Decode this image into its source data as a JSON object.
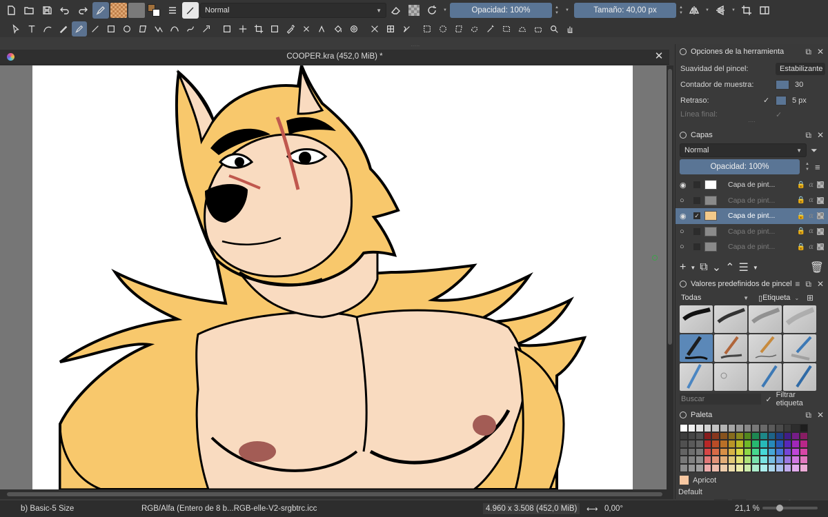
{
  "toolbar": {
    "blend_mode": "Normal",
    "opacity_label": "Opacidad: 100%",
    "size_label": "Tamaño: 40,00 px",
    "fg_color": "#a0703c",
    "bg_color": "#ffffff"
  },
  "document": {
    "title": "COOPER.kra (452,0 MiB) *"
  },
  "tool_options": {
    "title": "Opciones de la herramienta",
    "smoothing_label": "Suavidad del pincel:",
    "smoothing_value": "Estabilizante",
    "sample_label": "Contador de muestra:",
    "sample_value": "30",
    "delay_label": "Retraso:",
    "delay_value": "5 px",
    "final_label": "Línea final:"
  },
  "layers": {
    "title": "Capas",
    "blend_mode": "Normal",
    "opacity_label": "Opacidad:  100%",
    "items": [
      {
        "name": "Capa de pint...",
        "visible": true,
        "state": "normal",
        "thumb": "#ffffff"
      },
      {
        "name": "Capa de pint...",
        "visible": false,
        "state": "dim",
        "thumb": "#8a8a8a"
      },
      {
        "name": "Capa de pint...",
        "visible": true,
        "state": "selected",
        "thumb": "#f2c98a"
      },
      {
        "name": "Capa de pint...",
        "visible": false,
        "state": "dim",
        "thumb": "#8a8a8a"
      },
      {
        "name": "Capa de pint...",
        "visible": false,
        "state": "dim",
        "thumb": "#8a8a8a"
      }
    ]
  },
  "brush_presets": {
    "title": "Valores predefinidos de pincel",
    "filter_value": "Todas",
    "tag_label": "Etiqueta",
    "search_placeholder": "Buscar",
    "filter_tag_label": "Filtrar etiqueta"
  },
  "palette": {
    "title": "Paleta",
    "current_color_name": "Apricot",
    "current_color": "#f7c7a1",
    "palette_name": "Default"
  },
  "status": {
    "brush": "b) Basic-5 Size",
    "color_space": "RGB/Alfa (Entero de 8 b...RGB-elle-V2-srgbtrc.icc",
    "image_size": "4.960 x 3.508 (452,0 MiB)",
    "rotation": "0,00°",
    "zoom": "21,1 %"
  },
  "colors": {
    "accent": "#5a7595",
    "fur": "#f8c86c",
    "skin": "#f9dbc0",
    "nipple": "#a35c55",
    "scar": "#c0584e"
  }
}
